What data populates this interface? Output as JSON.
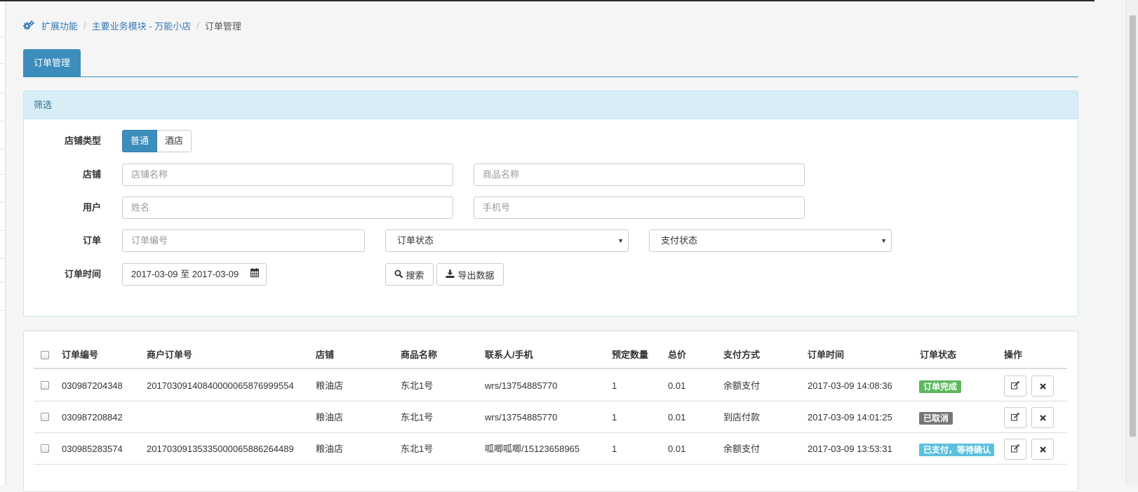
{
  "breadcrumb": {
    "items": [
      "扩展功能",
      "主要业务模块 - 万能小店",
      "订单管理"
    ],
    "separator": "/"
  },
  "tabs": [
    {
      "label": "订单管理",
      "active": true
    }
  ],
  "filter": {
    "title": "筛选",
    "shop_type": {
      "label": "店铺类型",
      "options": [
        "普通",
        "酒店"
      ],
      "selected": "普通"
    },
    "shop": {
      "label": "店铺",
      "shop_name_placeholder": "店铺名称",
      "goods_name_placeholder": "商品名称"
    },
    "user": {
      "label": "用户",
      "name_placeholder": "姓名",
      "phone_placeholder": "手机号"
    },
    "order": {
      "label": "订单",
      "order_no_placeholder": "订单编号",
      "order_status": "订单状态",
      "pay_status": "支付状态"
    },
    "order_time": {
      "label": "订单时间",
      "value": "2017-03-09 至 2017-03-09"
    },
    "search_label": "搜索",
    "export_label": "导出数据"
  },
  "table": {
    "columns": [
      "订单编号",
      "商户订单号",
      "店铺",
      "商品名称",
      "联系人/手机",
      "预定数量",
      "总价",
      "支付方式",
      "订单时间",
      "订单状态",
      "操作"
    ],
    "rows": [
      {
        "order_no": "030987204348",
        "merchant_no": "20170309140840000065876999554",
        "shop": "粮油店",
        "goods": "东北1号",
        "contact": "wrs/13754885770",
        "qty": "1",
        "total": "0.01",
        "pay_method": "余额支付",
        "time": "2017-03-09 14:08:36",
        "status": "订单完成",
        "status_color": "#5cb85c"
      },
      {
        "order_no": "030987208842",
        "merchant_no": "",
        "shop": "粮油店",
        "goods": "东北1号",
        "contact": "wrs/13754885770",
        "qty": "1",
        "total": "0.01",
        "pay_method": "到店付款",
        "time": "2017-03-09 14:01:25",
        "status": "已取消",
        "status_color": "#777777"
      },
      {
        "order_no": "030985283574",
        "merchant_no": "20170309135335000065886264489",
        "shop": "粮油店",
        "goods": "东北1号",
        "contact": "呱唧呱唧/15123658965",
        "qty": "1",
        "total": "0.01",
        "pay_method": "余额支付",
        "time": "2017-03-09 13:53:31",
        "status": "已支付，等待确认",
        "status_color": "#5bc0de"
      }
    ]
  },
  "colors": {
    "primary": "#3c8dbc",
    "link": "#337ab7",
    "panel_head_bg": "#d9edf7",
    "panel_head_text": "#31708f"
  },
  "icons": [
    "cogs-icon",
    "search-icon",
    "download-icon",
    "calendar-icon",
    "edit-icon",
    "close-icon",
    "caret-down-icon"
  ]
}
